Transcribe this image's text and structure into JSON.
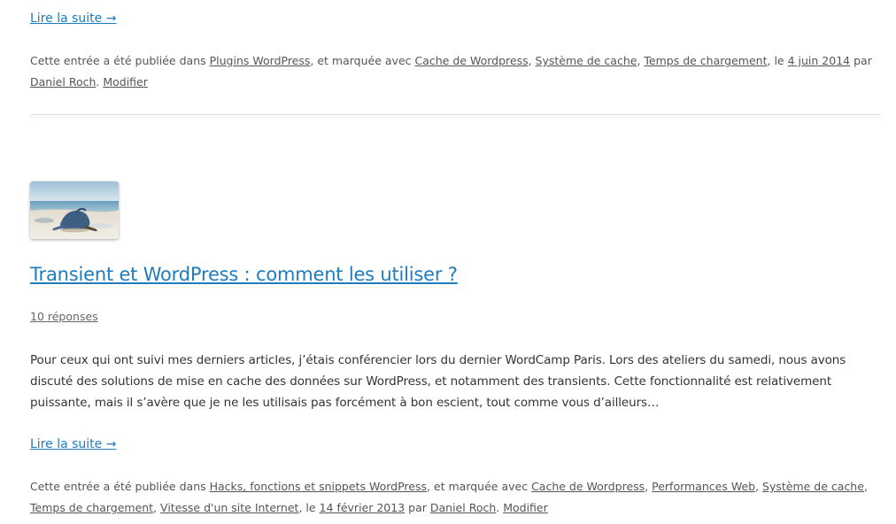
{
  "post_prev": {
    "read_more": "Lire la suite →",
    "meta": {
      "prefix": "Cette entrée a été publiée dans",
      "category": "Plugins WordPress",
      "tagged": ", et marquée avec",
      "tags": [
        "Cache de Wordpress",
        "Système de cache",
        "Temps de chargement"
      ],
      "date_prefix": ", le",
      "date": "4 juin 2014",
      "by": "par",
      "author": "Daniel Roch",
      "edit": "Modifier"
    }
  },
  "post": {
    "thumbnail_icon": "beach-thumbnail-image",
    "title": "Transient et WordPress : comment les utiliser ?",
    "replies": "10 réponses",
    "excerpt": "Pour ceux qui ont suivi mes derniers articles, j’étais conférencier lors du dernier WordCamp Paris. Lors des ateliers du samedi, nous avons discuté des solutions de mise en cache des données sur WordPress, et notamment des transients. Cette fonctionnalité est relativement puissante, mais il s’avère que je ne les utilisais pas forcément à bon escient, tout comme vous d’ailleurs…",
    "read_more": "Lire la suite →",
    "meta": {
      "prefix": "Cette entrée a été publiée dans",
      "category": "Hacks, fonctions et snippets WordPress",
      "tagged": ", et marquée avec",
      "tags": [
        "Cache de Wordpress",
        "Performances Web",
        "Système de cache",
        "Temps de chargement",
        "Vitesse d'un site Internet"
      ],
      "date_prefix": ", le",
      "date": "14 février 2013",
      "by": "par",
      "author": "Daniel Roch",
      "edit": "Modifier"
    }
  },
  "colors": {
    "link": "#1e7cbf",
    "meta_text": "#555555",
    "body_text": "#333333",
    "separator": "#d8d8d8"
  }
}
